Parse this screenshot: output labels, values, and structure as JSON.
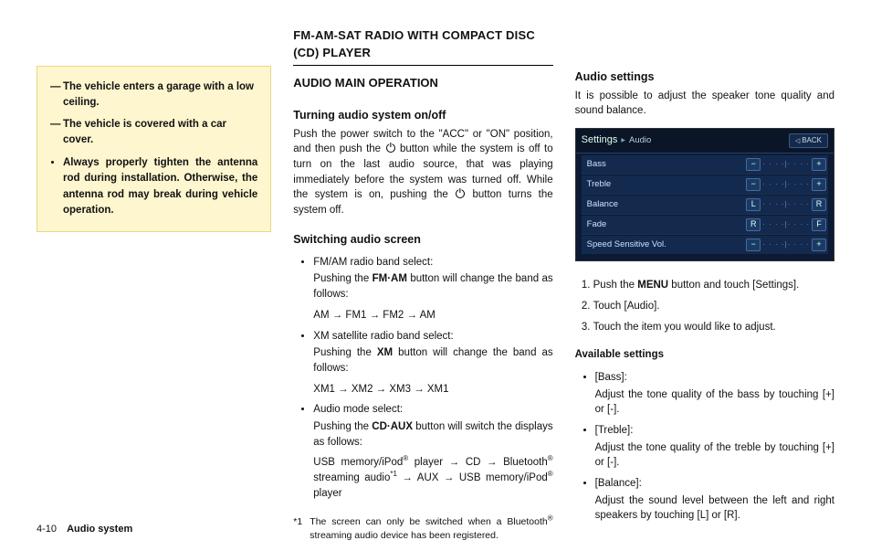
{
  "footer": {
    "page": "4-10",
    "section": "Audio system"
  },
  "callout": {
    "dash1": "The vehicle enters a garage with a low ceiling.",
    "dash2": "The vehicle is covered with a car cover.",
    "bullet": "Always properly tighten the antenna rod during installation. Otherwise, the antenna rod may break during vehicle operation."
  },
  "col2": {
    "head": "FM-AM-SAT RADIO WITH COMPACT DISC (CD) PLAYER",
    "sub1": "AUDIO MAIN OPERATION",
    "h_turning": "Turning audio system on/off",
    "turning_p1a": "Push the power switch to the \"ACC\" or \"ON\" position, and then push the ",
    "turning_p1b": " button while the system is off to turn on the last audio source, that was playing immediately before the system was turned off. While the system is on, pushing the ",
    "turning_p1c": " button turns the system off.",
    "h_switch": "Switching audio screen",
    "b1_title": "FM/AM radio band select:",
    "b1_l1a": "Pushing the ",
    "b1_l1_bold": "FM·AM",
    "b1_l1b": " button will change the band as follows:",
    "b1_seq": "AM → FM1 → FM2 → AM",
    "b2_title": "XM satellite radio band select:",
    "b2_l1a": "Pushing the ",
    "b2_l1_bold": "XM",
    "b2_l1b": " button will change the band as follows:",
    "b2_seq": "XM1 → XM2 → XM3 → XM1",
    "b3_title": "Audio mode select:",
    "b3_l1a": "Pushing the ",
    "b3_l1_bold": "CD·AUX",
    "b3_l1b": " button will switch the displays as follows:",
    "b3_seq_a": "USB memory/iPod",
    "b3_seq_b": " player → CD → Bluetooth",
    "b3_seq_c": " streaming audio",
    "b3_seq_star": "*1",
    "b3_seq_d": " → AUX → USB memory/iPod",
    "b3_seq_e": " player",
    "fn_mark": "*1",
    "fn_txt_a": "The screen can only be switched when a Bluetooth",
    "fn_txt_b": " streaming audio device has been registered."
  },
  "col3": {
    "h_audio": "Audio settings",
    "p1": "It is possible to adjust the speaker tone quality and sound balance.",
    "screen": {
      "title": "Settings",
      "crumb": "Audio",
      "back": "BACK",
      "rows": [
        {
          "label": "Bass",
          "left": "−",
          "right": "+"
        },
        {
          "label": "Treble",
          "left": "−",
          "right": "+"
        },
        {
          "label": "Balance",
          "left": "L",
          "right": "R"
        },
        {
          "label": "Fade",
          "left": "R",
          "right": "F"
        },
        {
          "label": "Speed Sensitive Vol.",
          "left": "−",
          "right": "+"
        }
      ]
    },
    "n1a": "Push the ",
    "n1_bold": "MENU",
    "n1b": " button and touch [Settings].",
    "n2": "Touch [Audio].",
    "n3": "Touch the item you would like to adjust.",
    "h_avail": "Available settings",
    "s1_title": "[Bass]:",
    "s1_body": "Adjust the tone quality of the bass by touching [+] or [-].",
    "s2_title": "[Treble]:",
    "s2_body": "Adjust the tone quality of the treble by touching [+] or [-].",
    "s3_title": "[Balance]:",
    "s3_body": "Adjust the sound level between the left and right speakers by touching [L] or [R]."
  }
}
